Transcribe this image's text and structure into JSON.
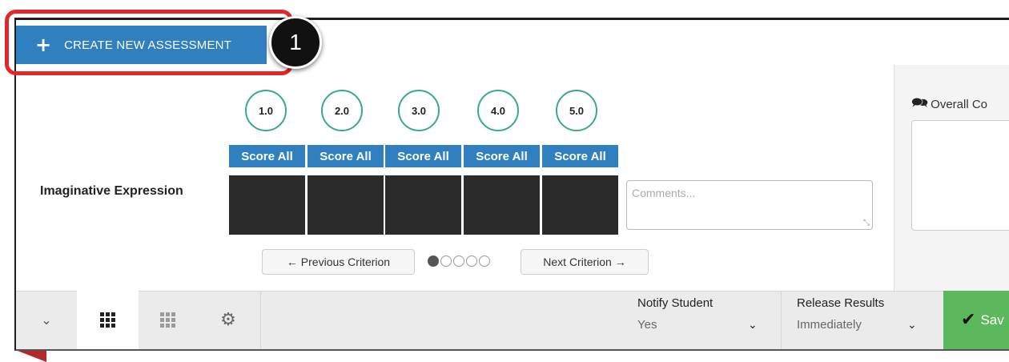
{
  "header": {
    "create_label": "CREATE NEW ASSESSMENT",
    "callout_number": "1"
  },
  "rubric": {
    "criterion_label": "Imaginative Expression",
    "scores": [
      "1.0",
      "2.0",
      "3.0",
      "4.0",
      "5.0"
    ],
    "score_all_label": "Score All",
    "comments_placeholder": "Comments...",
    "prev_label": "← Previous Criterion",
    "next_label": "Next Criterion →",
    "pagination": {
      "total": 5,
      "active": 1
    }
  },
  "side": {
    "overall_label": "Overall Co"
  },
  "bottom": {
    "notify_title": "Notify Student",
    "notify_value": "Yes",
    "release_title": "Release Results",
    "release_value": "Immediately",
    "save_label": "Sav"
  },
  "colors": {
    "primary": "#2f7fc1",
    "score_ring": "#3aa88f",
    "highlight": "#e2262c",
    "save": "#5cb85c"
  }
}
